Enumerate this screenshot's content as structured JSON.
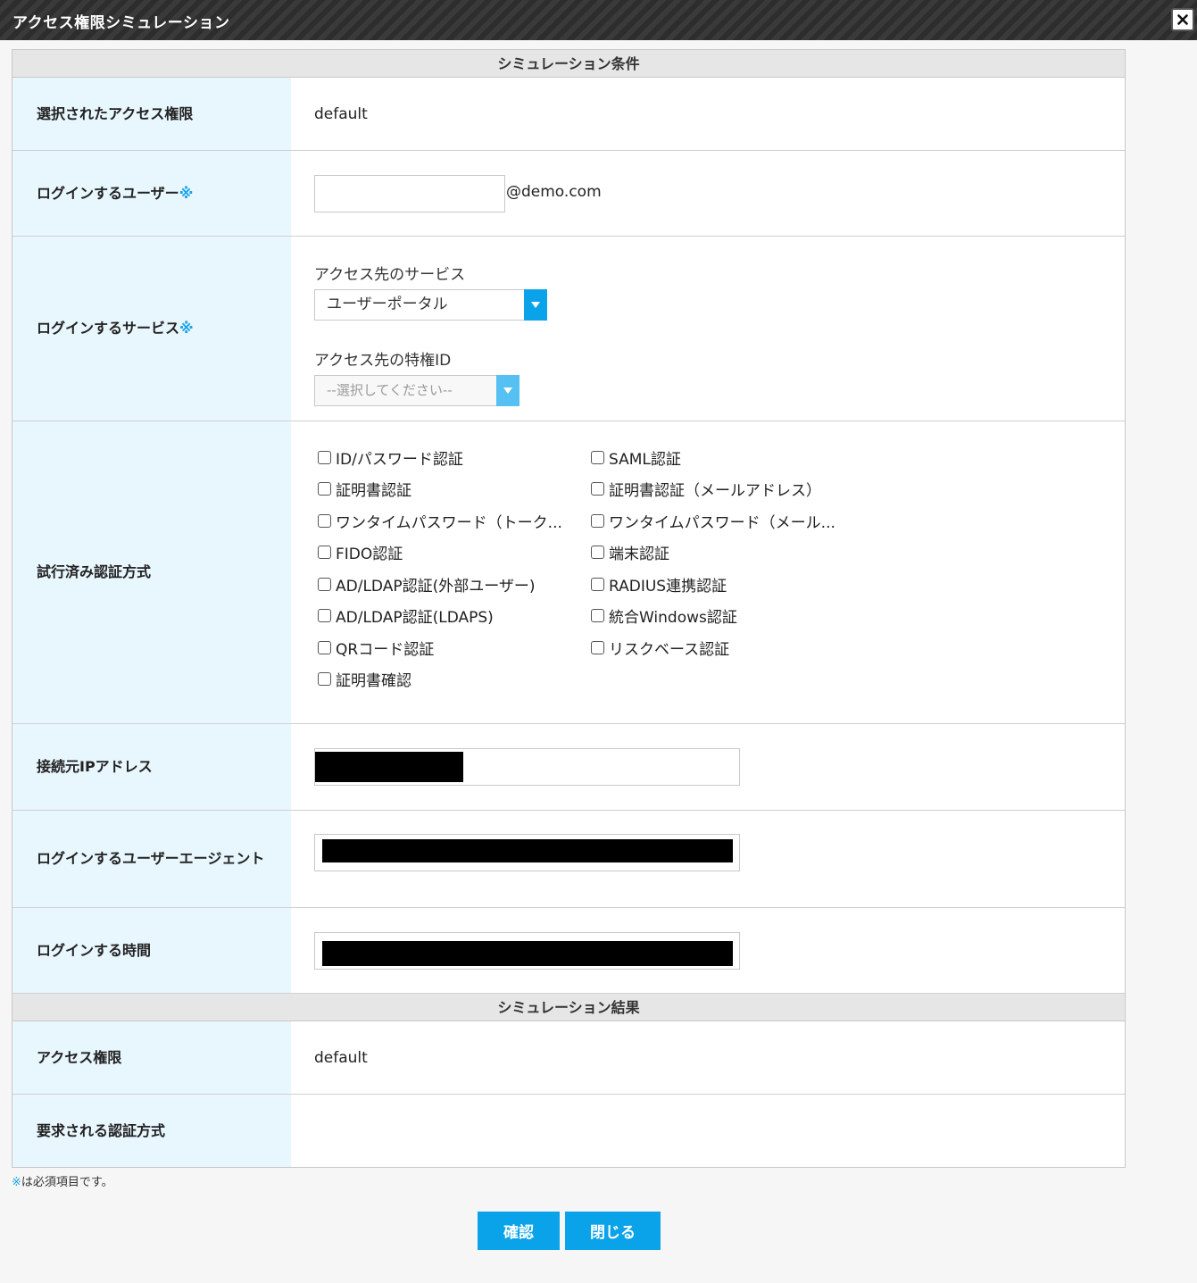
{
  "window": {
    "title": "アクセス権限シミュレーション"
  },
  "conditions": {
    "header": "シミュレーション条件",
    "selected_access": {
      "label": "選択されたアクセス権限",
      "value": "default"
    },
    "login_user": {
      "label": "ログインするユーザー",
      "required_mark": "※",
      "value": "",
      "domain_suffix": "@demo.com"
    },
    "login_service": {
      "label": "ログインするサービス",
      "required_mark": "※",
      "service_label": "アクセス先のサービス",
      "service_selected": "ユーザーポータル",
      "privilege_label": "アクセス先の特権ID",
      "privilege_placeholder": "--選択してください--"
    },
    "auth_methods": {
      "label": "試行済み認証方式",
      "options": [
        "ID/パスワード認証",
        "SAML認証",
        "証明書認証",
        "証明書認証（メールアドレス）",
        "ワンタイムパスワード（トーク...",
        "ワンタイムパスワード（メール...",
        "FIDO認証",
        "端末認証",
        "AD/LDAP認証(外部ユーザー)",
        "RADIUS連携認証",
        "AD/LDAP認証(LDAPS)",
        "統合Windows認証",
        "QRコード認証",
        "リスクベース認証",
        "証明書確認"
      ]
    },
    "source_ip": {
      "label": "接続元IPアドレス"
    },
    "user_agent": {
      "label": "ログインするユーザーエージェント"
    },
    "login_time": {
      "label": "ログインする時間"
    }
  },
  "results": {
    "header": "シミュレーション結果",
    "access": {
      "label": "アクセス権限",
      "value": "default"
    },
    "required_auth": {
      "label": "要求される認証方式",
      "value": ""
    }
  },
  "footnote": {
    "mark": "※",
    "text": "は必須項目です。"
  },
  "buttons": {
    "confirm": "確認",
    "close": "閉じる"
  },
  "colors": {
    "accent": "#0aa3ea",
    "label_bg": "#e8f6fe",
    "header_bg": "#e6e6e6"
  }
}
